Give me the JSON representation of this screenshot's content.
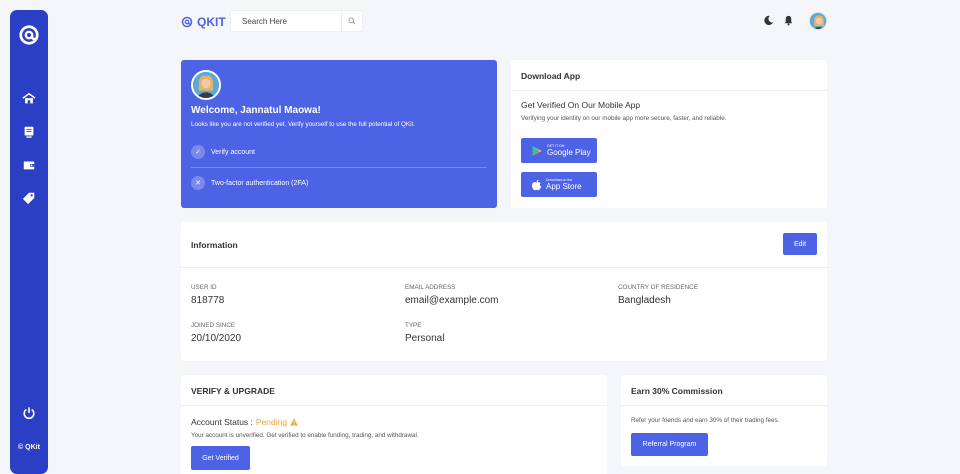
{
  "sidebar": {
    "logo_icon": "at-logo-icon",
    "items": [
      {
        "icon": "home-icon"
      },
      {
        "icon": "document-icon"
      },
      {
        "icon": "wallet-icon"
      },
      {
        "icon": "tag-icon"
      }
    ],
    "power_icon": "power-icon",
    "copyright": "© QKit"
  },
  "topbar": {
    "brand": "QKIT",
    "search_placeholder": "Search Here",
    "icons": [
      "search-icon",
      "moon-icon",
      "bell-icon",
      "avatar"
    ]
  },
  "welcome": {
    "title": "Welcome, Jannatul Maowa!",
    "subtitle": "Looks like you are not verified yet. Verify yourself to use the full potential of QKit.",
    "items": [
      {
        "label": "Verify account",
        "icon": "check-icon"
      },
      {
        "label": "Two-factor authentication (2FA)",
        "icon": "close-icon"
      }
    ]
  },
  "download": {
    "title": "Download App",
    "heading": "Get Verified On Our Mobile App",
    "description": "Verifying your identity on our mobile app more secure, faster, and reliable.",
    "google": {
      "small": "GET IT ON",
      "big": "Google Play"
    },
    "apple": {
      "small": "Download on the",
      "big": "App Store"
    }
  },
  "information": {
    "title": "Information",
    "edit_label": "Edit",
    "fields": [
      {
        "label": "User ID",
        "value": "818778"
      },
      {
        "label": "Email Address",
        "value": "email@example.com"
      },
      {
        "label": "Country of Residence",
        "value": "Bangladesh"
      },
      {
        "label": "Joined Since",
        "value": "20/10/2020"
      },
      {
        "label": "Type",
        "value": "Personal"
      }
    ]
  },
  "verify": {
    "title": "VERIFY & UPGRADE",
    "status_label": "Account Status :",
    "status_value": "Pending",
    "description": "Your account is unverified. Get verified to enable funding, trading, and withdrawal.",
    "button": "Get Verified",
    "accent": "#f0a33a"
  },
  "earn": {
    "title": "Earn 30% Commission",
    "description": "Refer your friends and earn 30% of their trading fees.",
    "button": "Referral Program"
  },
  "colors": {
    "primary": "#4c63e6",
    "sidebar": "#2a3fc4",
    "background": "#f5f6fa"
  }
}
